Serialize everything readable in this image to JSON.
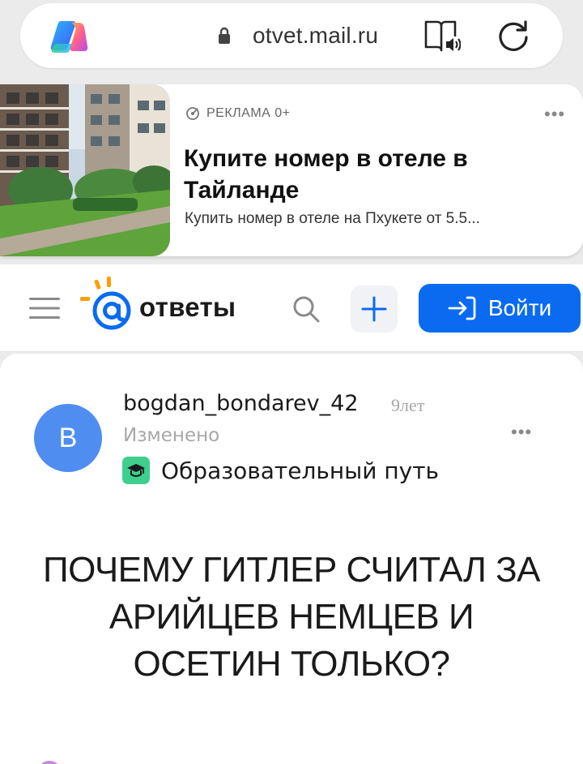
{
  "browser": {
    "url": "otvet.mail.ru",
    "icons": [
      "copilot-icon",
      "lock-icon",
      "reader-mode-icon",
      "reload-icon"
    ]
  },
  "ad": {
    "label": "РЕКЛАМА  0+",
    "title": "Купите номер в отеле в Тайланде",
    "description": "Купить номер в отеле на Пхукете от 5.5...",
    "more": "•••",
    "image": "hotel-courtyard-photo"
  },
  "header": {
    "logo_text": "ответы",
    "login_label": "Войти",
    "colors": {
      "accent": "#0a6bf0",
      "logo_blue": "#0a6bf0",
      "logo_orange": "#ff9e00"
    }
  },
  "question": {
    "avatar_letter": "B",
    "username": "bogdan_bondarev_42",
    "age": "9лет",
    "edited": "Изменено",
    "category": "Образовательный путь",
    "more": "•••",
    "title": "ПОЧЕМУ ГИТЛЕР СЧИТАЛ ЗА АРИЙЦЕВ НЕМЦЕВ И ОСЕТИН ТОЛЬКО?"
  }
}
